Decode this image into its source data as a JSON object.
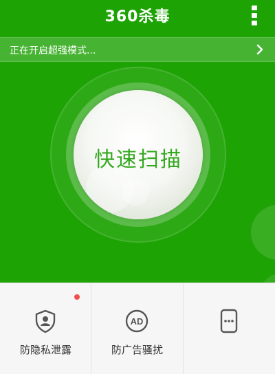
{
  "header": {
    "title": "360杀毒",
    "menu_icon": "more-vertical-icon"
  },
  "banner": {
    "text": "正在开启超强模式...",
    "chevron_icon": "chevron-right-icon"
  },
  "scan": {
    "label": "快速扫描"
  },
  "features": [
    {
      "label": "防隐私泄露",
      "icon": "shield-user-icon",
      "has_notification": true
    },
    {
      "label": "防广告骚扰",
      "icon": "ad-icon",
      "has_notification": false
    },
    {
      "label": "",
      "icon": "phone-message-icon",
      "has_notification": false
    }
  ],
  "colors": {
    "brand_green": "#1ea305",
    "scan_text_green": "#34a81e",
    "notification_red": "#f0504b",
    "icon_gray": "#555555"
  }
}
